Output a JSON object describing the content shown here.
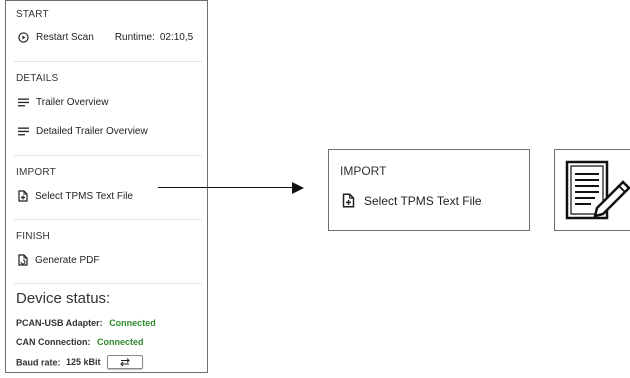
{
  "start": {
    "title": "START",
    "restart_label": "Restart Scan",
    "runtime_label": "Runtime:",
    "runtime_value": "02:10,5"
  },
  "details": {
    "title": "DETAILS",
    "items": [
      {
        "label": "Trailer Overview",
        "icon": "list-lines-icon"
      },
      {
        "label": "Detailed Trailer Overview",
        "icon": "list-lines-icon"
      }
    ]
  },
  "import": {
    "title": "IMPORT",
    "item_label": "Select TPMS Text File",
    "icon": "file-add-icon"
  },
  "finish": {
    "title": "FINISH",
    "item_label": "Generate PDF",
    "icon": "file-refresh-icon"
  },
  "device_status": {
    "title": "Device status:",
    "adapter_label": "PCAN-USB Adapter:",
    "adapter_value": "Connected",
    "can_label": "CAN Connection:",
    "can_value": "Connected",
    "baud_label": "Baud rate:",
    "baud_value": "125 kBit",
    "baud_button_icon": "swap-arrows-icon"
  },
  "zoom_callout": {
    "title": "IMPORT",
    "item_label": "Select TPMS Text File",
    "icon": "file-add-icon"
  },
  "doc_illustration": {
    "icon": "document-pen-icon"
  },
  "colors": {
    "connected": "#2e8b2e",
    "border": "#6f6f6f"
  }
}
